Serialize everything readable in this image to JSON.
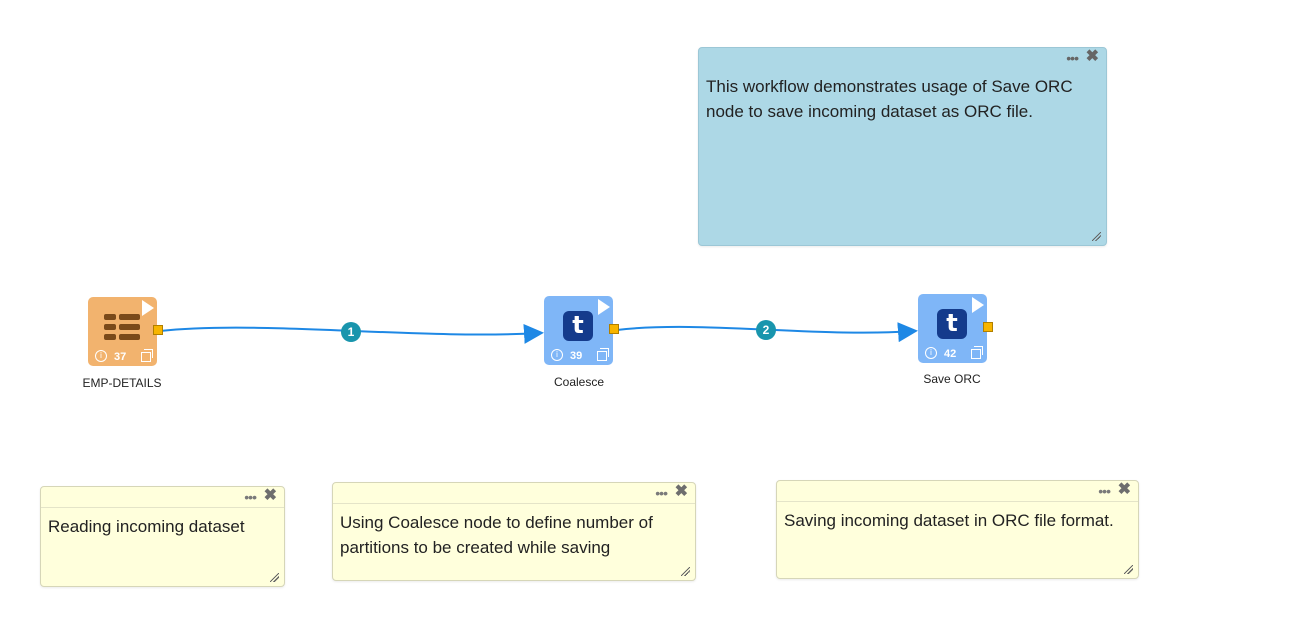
{
  "nodes": [
    {
      "id": "emp",
      "label": "EMP-DETAILS",
      "number": "37",
      "icon": "table-icon"
    },
    {
      "id": "coalesce",
      "label": "Coalesce",
      "number": "39",
      "icon": "t-icon"
    },
    {
      "id": "saveorc",
      "label": "Save ORC",
      "number": "42",
      "icon": "t-icon"
    }
  ],
  "edges": [
    {
      "from": "emp",
      "to": "coalesce",
      "label": "1"
    },
    {
      "from": "coalesce",
      "to": "saveorc",
      "label": "2"
    }
  ],
  "notes": {
    "description": "This workflow demonstrates usage of Save ORC node to save incoming dataset as ORC file.",
    "reading": "Reading incoming dataset",
    "coalesce": "Using Coalesce node to define number of partitions to be created while saving",
    "saving": "Saving incoming dataset in ORC file format."
  },
  "icons": {
    "info": "i",
    "t_glyph": "t",
    "dots": "•••",
    "close": "✖"
  },
  "colors": {
    "read_node": "#f2b36e",
    "transform_node": "#7fb6f7",
    "edge": "#1e88e5",
    "edge_badge": "#1995ad",
    "note_yellow": "#ffffdc",
    "note_blue": "#add8e6"
  }
}
